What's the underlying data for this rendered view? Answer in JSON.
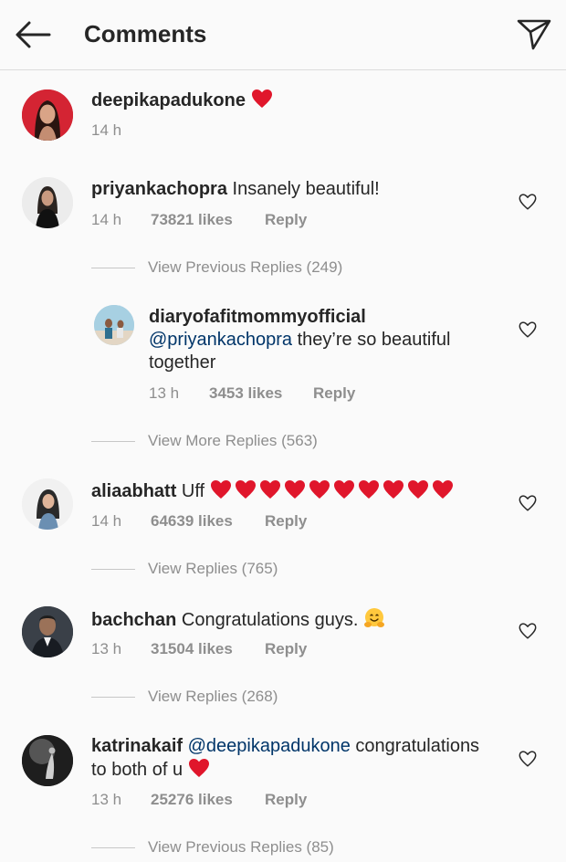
{
  "header": {
    "title": "Comments"
  },
  "post": {
    "username": "deepikapadukone",
    "caption_emoji": "red-heart",
    "time": "14 h"
  },
  "comments": [
    {
      "username": "priyankachopra",
      "text": "Insanely beautiful!",
      "time": "14 h",
      "likes": "73821 likes",
      "reply": "Reply",
      "view_replies": "View Previous Replies (249)",
      "replies": [
        {
          "username": "diaryofafitmommyofficial",
          "mention": "@priyankachopra",
          "text": " they’re so beautiful together",
          "time": "13 h",
          "likes": "3453 likes",
          "reply": "Reply"
        }
      ],
      "view_more": "View More Replies (563)"
    },
    {
      "username": "aliaabhatt",
      "text": "Uff",
      "hearts": 10,
      "time": "14 h",
      "likes": "64639 likes",
      "reply": "Reply",
      "view_replies": "View Replies (765)"
    },
    {
      "username": "bachchan",
      "text": "Congratulations guys.",
      "emoji": "hugging-face",
      "time": "13 h",
      "likes": "31504 likes",
      "reply": "Reply",
      "view_replies": "View Replies (268)"
    },
    {
      "username": "katrinakaif",
      "mention": "@deepikapadukone",
      "text_line1": " congratulations",
      "text_line2": "to both of u",
      "time": "13 h",
      "likes": "25276 likes",
      "reply": "Reply",
      "view_replies": "View Previous Replies (85)"
    }
  ],
  "colors": {
    "heart": "#e0162b",
    "mention": "#003569",
    "muted": "#8e8e8e",
    "text": "#262626"
  }
}
